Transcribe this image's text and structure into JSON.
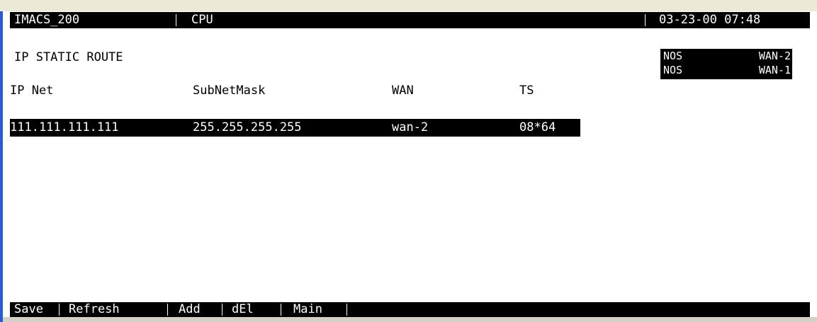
{
  "header": {
    "system_name": "IMACS_200",
    "module": "CPU",
    "datetime": "03-23-00 07:48"
  },
  "page_title": "IP STATIC ROUTE",
  "status_panel": [
    {
      "left": "NOS",
      "right": "WAN-2"
    },
    {
      "left": "NOS",
      "right": "WAN-1"
    }
  ],
  "table": {
    "columns": [
      "IP Net",
      "SubNetMask",
      "WAN",
      "TS"
    ],
    "rows": [
      {
        "ip_net": "111.111.111.111",
        "subnet_mask": "255.255.255.255",
        "wan": "wan-2",
        "ts": "08*64"
      }
    ]
  },
  "footer_menu": [
    "Save",
    "Refresh",
    "Add",
    "dEl",
    "Main"
  ]
}
